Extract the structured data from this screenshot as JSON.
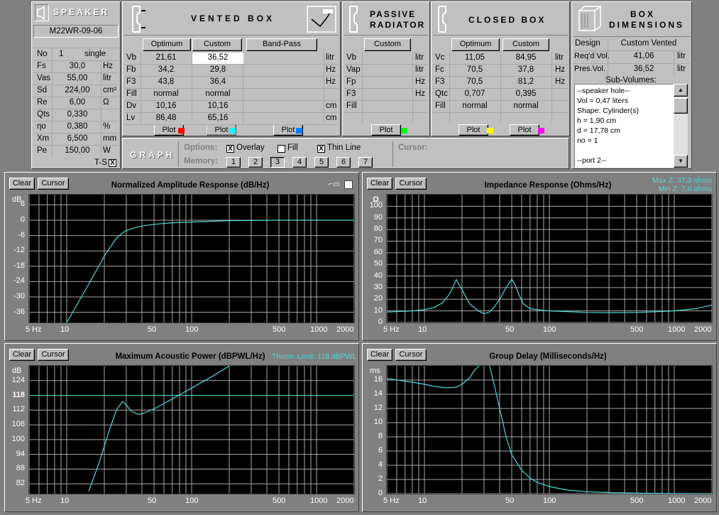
{
  "speaker": {
    "header": "SPEAKER",
    "model": "M22WR-09-06",
    "no_label": "No",
    "no_value": "1",
    "no_mode": "single",
    "rows": [
      {
        "name": "Fs",
        "value": "30,0",
        "unit": "Hz"
      },
      {
        "name": "Vas",
        "value": "55,00",
        "unit": "litr"
      },
      {
        "name": "Sd",
        "value": "224,00",
        "unit": "cm²"
      },
      {
        "name": "Re",
        "value": "6,00",
        "unit": "Ω"
      },
      {
        "name": "Qts",
        "value": "0,330",
        "unit": ""
      },
      {
        "name": "ηo",
        "value": "0,380",
        "unit": "%"
      },
      {
        "name": "Xm",
        "value": "6,500",
        "unit": "mm"
      },
      {
        "name": "Pe",
        "value": "150,00",
        "unit": "W"
      }
    ],
    "ts_label": "T-S",
    "ts_checked": "X"
  },
  "vented": {
    "header": "VENTED BOX",
    "buttons": [
      "Optimum",
      "Custom",
      "Band-Pass"
    ],
    "rows": [
      {
        "name": "Vb",
        "opt": "21,61",
        "cus": "36,52",
        "unit": "litr"
      },
      {
        "name": "Fb",
        "opt": "34,2",
        "cus": "29,8",
        "unit": "Hz"
      },
      {
        "name": "F3",
        "opt": "43,8",
        "cus": "36,4",
        "unit": "Hz"
      },
      {
        "name": "Fill",
        "opt": "normal",
        "cus": "normal",
        "unit": ""
      },
      {
        "name": "Dv",
        "opt": "10,16",
        "cus": "10,16",
        "unit": "cm"
      },
      {
        "name": "Lv",
        "opt": "86,48",
        "cus": "65,16",
        "unit": "cm"
      }
    ],
    "plot_label": "Plot"
  },
  "passive": {
    "header1": "PASSIVE",
    "header2": "RADIATOR",
    "button": "Custom",
    "rows": [
      {
        "name": "Vb",
        "unit": "litr"
      },
      {
        "name": "Vap",
        "unit": "litr"
      },
      {
        "name": "Fp",
        "unit": "Hz"
      },
      {
        "name": "F3",
        "unit": "Hz"
      },
      {
        "name": "Fill",
        "unit": ""
      }
    ],
    "plot_label": "Plot"
  },
  "closed": {
    "header": "CLOSED BOX",
    "buttons": [
      "Optimum",
      "Custom"
    ],
    "rows": [
      {
        "name": "Vc",
        "opt": "11,05",
        "cus": "84,95",
        "unit": "litr"
      },
      {
        "name": "Fc",
        "opt": "70,5",
        "cus": "37,8",
        "unit": "Hz"
      },
      {
        "name": "F3",
        "opt": "70,5",
        "cus": "81,2",
        "unit": "Hz"
      },
      {
        "name": "Qtc",
        "opt": "0,707",
        "cus": "0,395",
        "unit": ""
      },
      {
        "name": "Fill",
        "opt": "normal",
        "cus": "normal",
        "unit": ""
      }
    ],
    "plot_label": "Plot"
  },
  "box_dimensions": {
    "header1": "BOX",
    "header2": "DIMENSIONS",
    "design_label": "Design",
    "design_value": "Custom Vented",
    "reqd_label": "Req'd Vol.",
    "reqd_value": "41,06",
    "reqd_unit": "litr",
    "pres_label": "Pres.Vol.",
    "pres_value": "36,52",
    "pres_unit": "litr",
    "subvol_label": "Sub-Volumes:",
    "subvol_lines": [
      "--speaker hole--",
      "Vol = 0,47 liters",
      "Shape: Cylinder(s)",
      "h = 1,90 cm",
      "d = 17,78 cm",
      "no = 1",
      "",
      "--port 2--"
    ]
  },
  "graph_bar": {
    "label": "GRAPH",
    "options_label": "Options:",
    "overlay": "Overlay",
    "overlay_checked": "X",
    "fill": "Fill",
    "fill_checked": "",
    "thin_line": "Thin Line",
    "thin_checked": "X",
    "cursor_label": "Cursor:",
    "memory_label": "Memory:",
    "memory_buttons": [
      "1",
      "2",
      "3",
      "4",
      "5",
      "6",
      "7"
    ]
  },
  "colors": {
    "trace": "#4fd8d8",
    "plot_bg": "#000000",
    "grid": "#a8a8a8",
    "swatch_red": "#ff0000",
    "swatch_cyan": "#00ffff",
    "swatch_blue": "#0080ff",
    "swatch_green": "#00ff00",
    "swatch_yellow": "#ffff00",
    "swatch_magenta": "#ff00ff"
  },
  "graphs": {
    "clear_label": "Clear",
    "cursor_label": "Cursor",
    "xticks": [
      "5 Hz",
      "10",
      "50",
      "100",
      "500",
      "1000",
      "2000"
    ]
  },
  "chart_data": [
    {
      "type": "line",
      "title": "Normalized Amplitude Response (dB/Hz)",
      "ylabel": "dB",
      "xscale": "log",
      "xlim": [
        5,
        2000
      ],
      "ylim": [
        -40,
        10
      ],
      "yticks": [
        "6",
        "0",
        "-6",
        "-12",
        "-18",
        "-24",
        "-30",
        "-36"
      ],
      "x": [
        10,
        15,
        20,
        25,
        28,
        30,
        33,
        36,
        40,
        50,
        70,
        100,
        150,
        200,
        300,
        500,
        1000,
        2000
      ],
      "y": [
        -40,
        -25,
        -14,
        -7,
        -5,
        -4,
        -3.4,
        -2.8,
        -2.3,
        -1.6,
        -1.0,
        -0.7,
        -0.4,
        -0.2,
        -0.1,
        0,
        0,
        0
      ]
    },
    {
      "type": "line",
      "title": "Impedance Response (Ohms/Hz)",
      "ylabel": "Ω",
      "xscale": "log",
      "xlim": [
        5,
        2000
      ],
      "ylim": [
        0,
        110
      ],
      "yticks": [
        "100",
        "90",
        "80",
        "70",
        "60",
        "50",
        "40",
        "30",
        "20",
        "10",
        "0"
      ],
      "annotations": [
        "Max Z: 37,3 ohms",
        "Min Z: 7,6 ohms"
      ],
      "x": [
        5,
        8,
        10,
        12,
        14,
        16,
        18,
        20,
        23,
        27,
        30,
        33,
        36,
        40,
        45,
        50,
        53,
        57,
        62,
        70,
        80,
        100,
        150,
        200,
        300,
        500,
        700,
        1000,
        1500,
        2000
      ],
      "y": [
        9,
        10,
        11,
        13,
        17,
        25,
        37,
        28,
        16,
        10,
        7.6,
        9,
        13,
        20,
        30,
        37.3,
        33,
        24,
        16,
        12,
        11,
        10,
        9.2,
        8.7,
        8.5,
        8.7,
        9.2,
        10,
        12,
        15
      ]
    },
    {
      "type": "line",
      "title": "Maximum Acoustic Power (dBPWL/Hz)",
      "ylabel": "dB",
      "xscale": "log",
      "xlim": [
        5,
        2000
      ],
      "ylim": [
        78,
        130
      ],
      "yticks": [
        "124",
        "118",
        "112",
        "106",
        "100",
        "94",
        "88",
        "82"
      ],
      "annotations": [
        "Therm. Limit: 118 dBPWL"
      ],
      "x": [
        15,
        18,
        22,
        25,
        28,
        30,
        33,
        37,
        40,
        45,
        50,
        70,
        100,
        150,
        200
      ],
      "y": [
        79,
        90,
        104,
        112,
        115.5,
        114,
        111.5,
        110.3,
        110.5,
        111.5,
        112.5,
        116.5,
        121,
        126,
        130
      ]
    },
    {
      "type": "line",
      "title": "Group Delay (Milliseconds/Hz)",
      "ylabel": "ms",
      "xscale": "log",
      "xlim": [
        5,
        2000
      ],
      "ylim": [
        0,
        18
      ],
      "yticks": [
        "16",
        "14",
        "12",
        "10",
        "8",
        "6",
        "4",
        "2",
        "0"
      ],
      "x": [
        5,
        8,
        10,
        12,
        15,
        18,
        20,
        23,
        25,
        28,
        30,
        33,
        36,
        40,
        45,
        50,
        60,
        70,
        80,
        100,
        130,
        150,
        200,
        300,
        500,
        1000,
        2000
      ],
      "y": [
        16.2,
        15.7,
        15.4,
        15.1,
        14.9,
        15.0,
        15.4,
        16.3,
        17.3,
        19,
        20,
        18.5,
        15.5,
        12,
        8,
        5.5,
        3.3,
        2.2,
        1.6,
        1.0,
        0.6,
        0.45,
        0.28,
        0.15,
        0.08,
        0.04,
        0.02
      ]
    }
  ]
}
